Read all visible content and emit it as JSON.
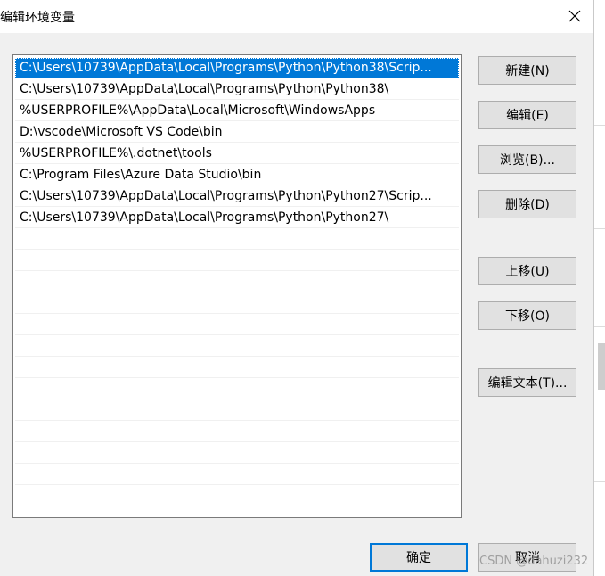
{
  "window": {
    "title": "编辑环境变量",
    "close_icon": "close-icon"
  },
  "path_list": {
    "selected_index": 0,
    "items": [
      "C:\\Users\\10739\\AppData\\Local\\Programs\\Python\\Python38\\Scrip...",
      "C:\\Users\\10739\\AppData\\Local\\Programs\\Python\\Python38\\",
      "%USERPROFILE%\\AppData\\Local\\Microsoft\\WindowsApps",
      "D:\\vscode\\Microsoft VS Code\\bin",
      "%USERPROFILE%\\.dotnet\\tools",
      "C:\\Program Files\\Azure Data Studio\\bin",
      "C:\\Users\\10739\\AppData\\Local\\Programs\\Python\\Python27\\Scrip...",
      "C:\\Users\\10739\\AppData\\Local\\Programs\\Python\\Python27\\"
    ],
    "empty_rows": 13
  },
  "buttons": {
    "new": "新建(N)",
    "edit": "编辑(E)",
    "browse": "浏览(B)...",
    "delete": "删除(D)",
    "move_up": "上移(U)",
    "move_down": "下移(O)",
    "edit_text": "编辑文本(T)...",
    "ok": "确定",
    "cancel": "取消"
  },
  "watermark": "CSDN @dahuzi232",
  "colors": {
    "selection": "#0078d7",
    "dialog_bg": "#f0f0f0",
    "button_bg": "#e1e1e1",
    "button_border": "#adadad",
    "default_button_border": "#0078d7"
  }
}
